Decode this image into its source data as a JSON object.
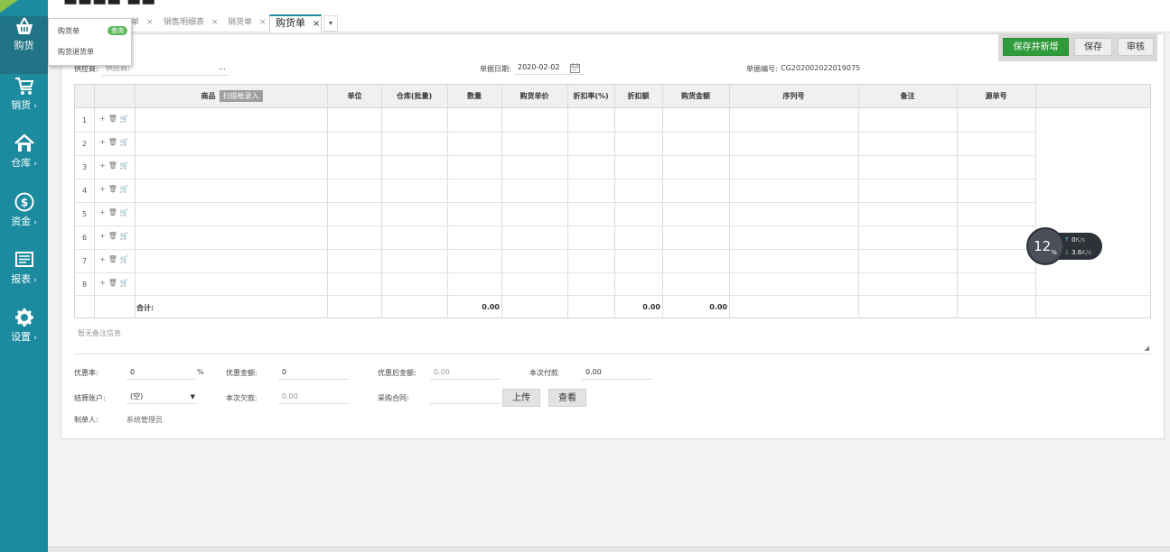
{
  "sidebar": {
    "items": [
      {
        "label": "购货",
        "icon": "basket-icon"
      },
      {
        "label": "销货",
        "icon": "cart-icon"
      },
      {
        "label": "仓库",
        "icon": "house-icon"
      },
      {
        "label": "资金",
        "icon": "dollar-icon"
      },
      {
        "label": "报表",
        "icon": "report-icon"
      },
      {
        "label": "设置",
        "icon": "gear-icon"
      }
    ],
    "arrow": "›"
  },
  "tabs": [
    {
      "label": "单"
    },
    {
      "label": "销售明细表"
    },
    {
      "label": "销货单"
    },
    {
      "label": "购货单"
    }
  ],
  "tab_close": "×",
  "tab_more": "▾",
  "dropdown": {
    "items": [
      {
        "label": "购货单",
        "badge": "查询"
      },
      {
        "label": "购货退货单"
      }
    ]
  },
  "toolbar": {
    "save_new": "保存并新增",
    "save": "保存",
    "review": "审核"
  },
  "form": {
    "supplier_label": "供应商:",
    "supplier_value": "供应商:",
    "supplier_more": "...",
    "date_label": "单据日期:",
    "date_value": "2020-02-02",
    "number_label": "单据编号:",
    "number_value": "CG202002022019075"
  },
  "grid": {
    "columns": [
      "商品",
      "单位",
      "仓库(批量)",
      "数量",
      "购货单价",
      "折扣率(%)",
      "折扣额",
      "购货金额",
      "序列号",
      "备注",
      "源单号"
    ],
    "scan_button": "扫描枪录入",
    "rows": [
      "1",
      "2",
      "3",
      "4",
      "5",
      "6",
      "7",
      "8"
    ],
    "row_ops": {
      "add": "+",
      "delete": "🗑",
      "cart": "🛒"
    },
    "total_label": "合计:",
    "total_qty": "0.00",
    "total_discount": "0.00",
    "total_amount": "0.00"
  },
  "note_placeholder": "暂无备注信息",
  "footer": {
    "discount_rate_label": "优惠率:",
    "discount_rate_value": "0",
    "percent": "%",
    "discount_amount_label": "优惠金额:",
    "discount_amount_value": "0",
    "after_discount_label": "优惠后金额:",
    "after_discount_value": "0.00",
    "payment_label": "本次付款",
    "payment_value": "0.00",
    "account_label": "结算账户:",
    "account_value": "(空)",
    "debt_label": "本次欠款:",
    "debt_value": "0.00",
    "contract_label": "采购合同:",
    "upload": "上传",
    "view": "查看",
    "maker_label": "制单人:",
    "maker_value": "系统管理员"
  },
  "net_widget": {
    "percent": "12",
    "percent_unit": "%",
    "up": "0",
    "down": "3.6",
    "unit": "K/s"
  },
  "colors": {
    "sidebar": "#1c8ba0",
    "primary_button": "#2f9b3a"
  }
}
